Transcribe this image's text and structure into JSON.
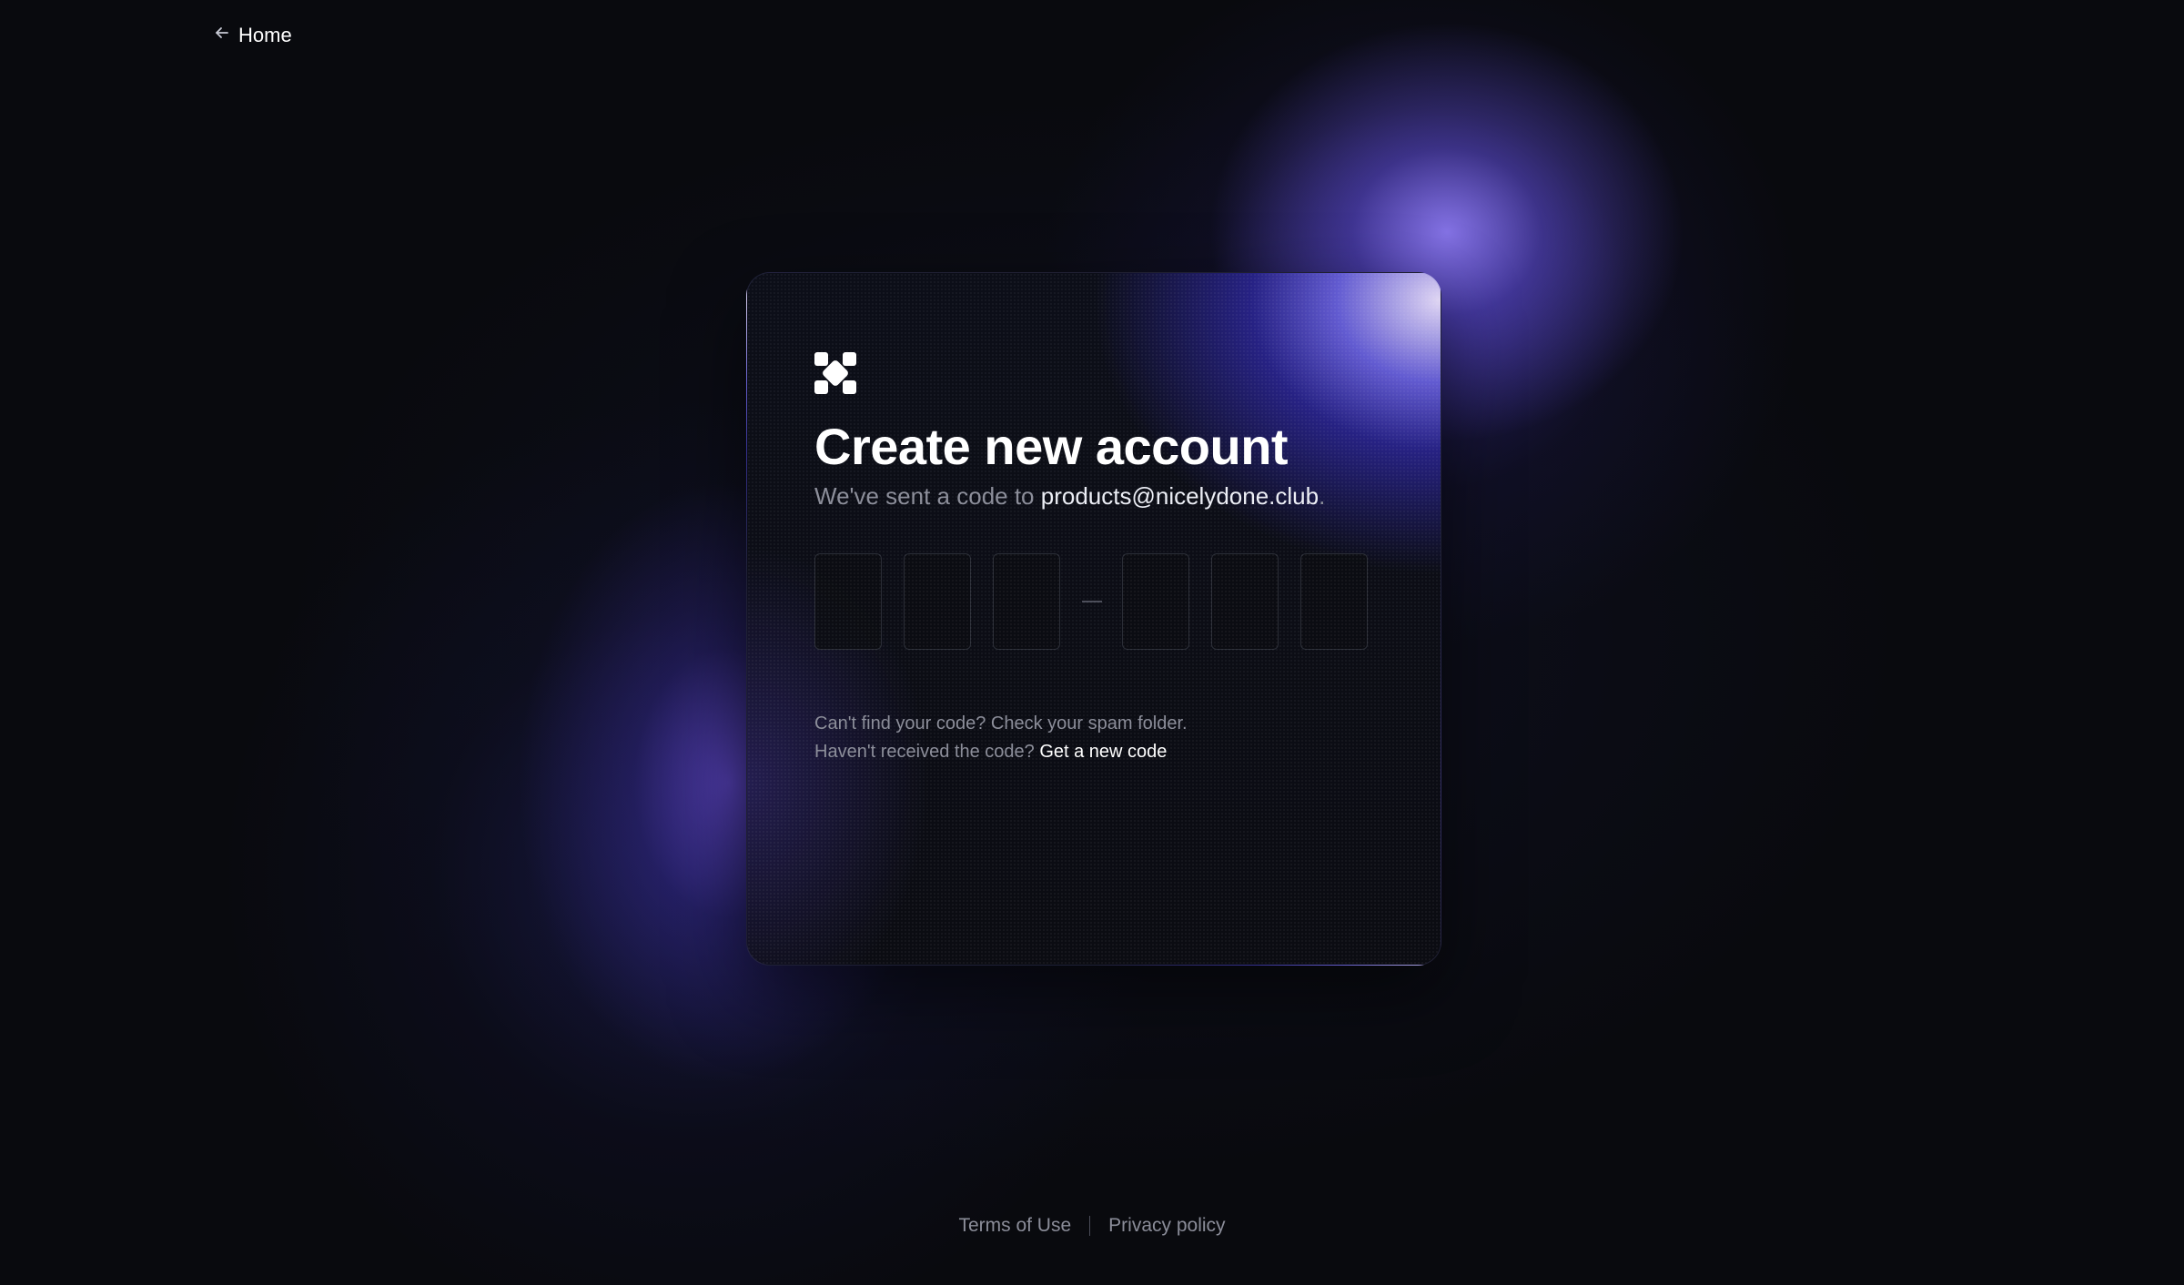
{
  "nav": {
    "back_label": "Home",
    "back_icon": "arrow-left-icon"
  },
  "card": {
    "logo_icon": "brand-logo-icon",
    "title": "Create new account",
    "subtitle_prefix": "We've sent a code to ",
    "email": "products@nicelydone.club",
    "subtitle_suffix": ".",
    "code_inputs": [
      "",
      "",
      "",
      "",
      "",
      ""
    ],
    "code_separator": "—",
    "help_line1": "Can't find your code? Check your spam folder.",
    "help_line2_prefix": "Haven't received the code? ",
    "resend_link": "Get a new code"
  },
  "footer": {
    "terms": "Terms of Use",
    "privacy": "Privacy policy"
  },
  "colors": {
    "background": "#090a0e",
    "accent": "#7b6cff",
    "muted_text": "#8b8d99"
  }
}
